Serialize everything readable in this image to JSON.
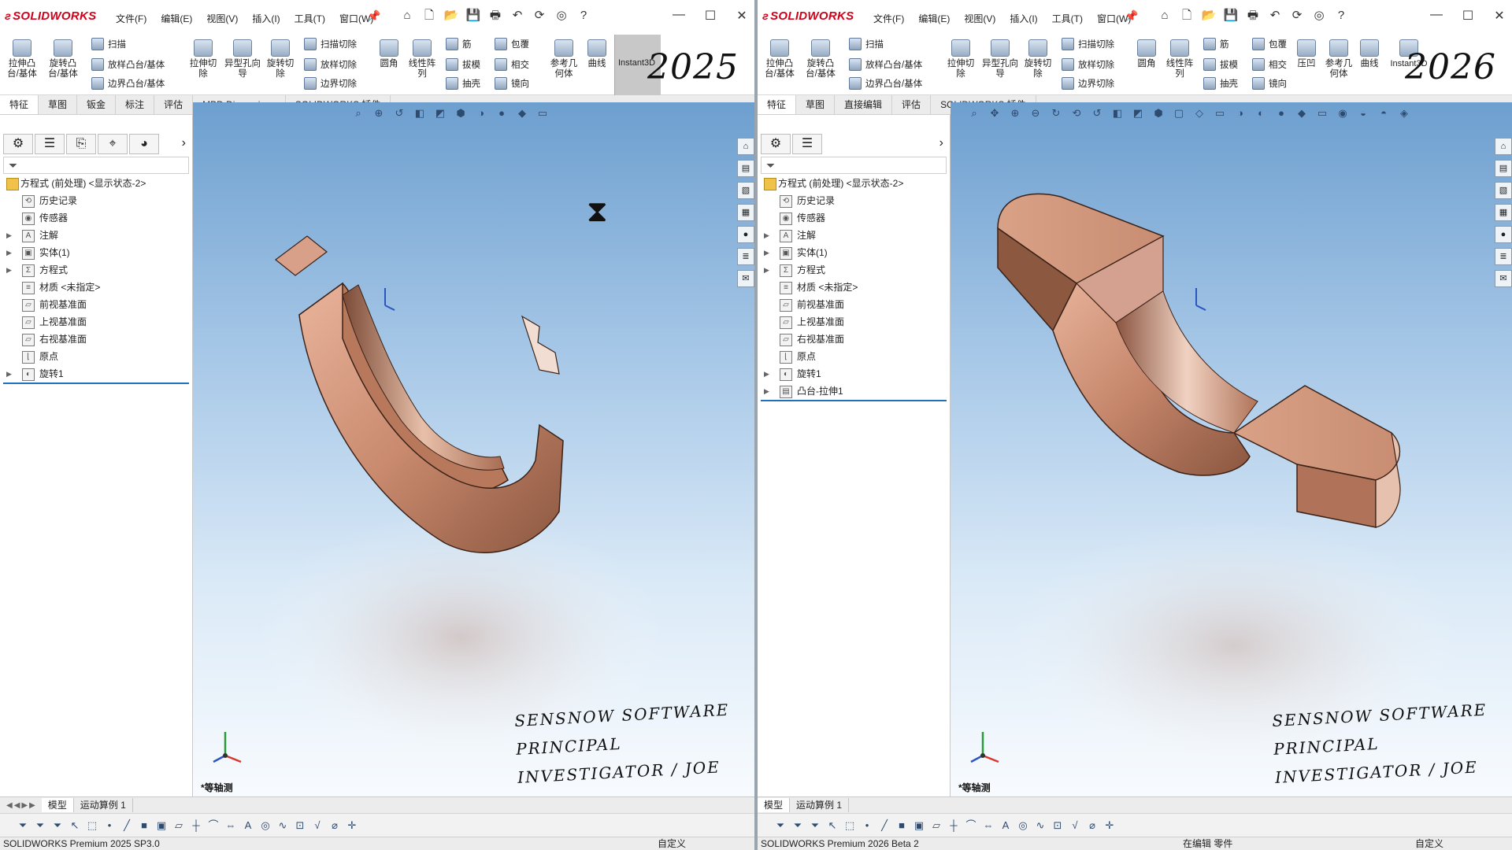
{
  "colors": {
    "accent": "#d0021b",
    "viewport_top": "#6d9fcf",
    "viewport_bottom": "#f8fbfe",
    "part_copper": "#c98a6e"
  },
  "left": {
    "logo": "SOLIDWORKS",
    "menus": [
      "文件(F)",
      "编辑(E)",
      "视图(V)",
      "插入(I)",
      "工具(T)",
      "窗口(W)"
    ],
    "ribbon": {
      "big": [
        "拉伸凸台/基体",
        "旋转凸台/基体",
        "拉伸切除",
        "异型孔向导",
        "旋转切除",
        "圆角",
        "线性阵列",
        "参考几何体",
        "曲线"
      ],
      "small": [
        "扫描",
        "放样凸台/基体",
        "边界凸台/基体",
        "扫描切除",
        "放样切除",
        "边界切除",
        "筋",
        "拔模",
        "抽壳",
        "包覆",
        "相交",
        "镜向"
      ],
      "instant": "Instant3D",
      "version": "2025"
    },
    "tabs": [
      "特征",
      "草图",
      "钣金",
      "标注",
      "评估",
      "MBD Dimensions",
      "SOLIDWORKS 插件"
    ],
    "tree": {
      "root": "方程式 (前处理) <显示状态-2>",
      "items": [
        "历史记录",
        "传感器",
        "注解",
        "实体(1)",
        "方程式",
        "材质 <未指定>",
        "前视基准面",
        "上视基准面",
        "右视基准面",
        "原点",
        "旋转1"
      ]
    },
    "view_name": "*等轴测",
    "signature": [
      "SENSNOW SOFTWARE",
      "PRINCIPAL INVESTIGATOR / JOE"
    ],
    "bottom_tabs": [
      "模型",
      "运动算例 1"
    ],
    "status": {
      "left": "SOLIDWORKS Premium 2025 SP3.0",
      "middle": "",
      "right": "自定义"
    }
  },
  "right": {
    "logo": "SOLIDWORKS",
    "menus": [
      "文件(F)",
      "编辑(E)",
      "视图(V)",
      "插入(I)",
      "工具(T)",
      "窗口(W)"
    ],
    "ribbon": {
      "big": [
        "拉伸凸台/基体",
        "旋转凸台/基体",
        "拉伸切除",
        "异型孔向导",
        "旋转切除",
        "圆角",
        "线性阵列",
        "压凹",
        "参考几何体",
        "曲线"
      ],
      "small": [
        "扫描",
        "放样凸台/基体",
        "边界凸台/基体",
        "扫描切除",
        "放样切除",
        "边界切除",
        "筋",
        "拔模",
        "抽壳",
        "包覆",
        "相交",
        "镜向"
      ],
      "instant": "Instant3D",
      "version": "2026"
    },
    "tabs": [
      "特征",
      "草图",
      "直接编辑",
      "评估",
      "SOLIDWORKS 插件"
    ],
    "tree": {
      "root": "方程式 (前处理) <显示状态-2>",
      "items": [
        "历史记录",
        "传感器",
        "注解",
        "实体(1)",
        "方程式",
        "材质 <未指定>",
        "前视基准面",
        "上视基准面",
        "右视基准面",
        "原点",
        "旋转1",
        "凸台-拉伸1"
      ]
    },
    "view_name": "*等轴测",
    "signature": [
      "SENSNOW SOFTWARE",
      "PRINCIPAL INVESTIGATOR / JOE"
    ],
    "bottom_tabs": [
      "模型",
      "运动算例 1"
    ],
    "status": {
      "left": "SOLIDWORKS Premium 2026 Beta 2",
      "middle": "在编辑 零件",
      "right": "自定义"
    }
  }
}
